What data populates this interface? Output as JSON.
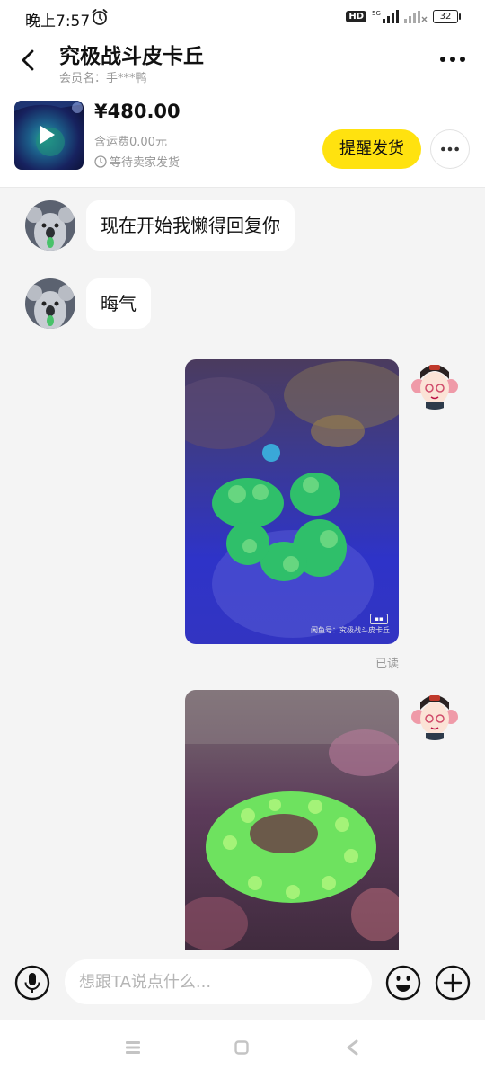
{
  "status_bar": {
    "time": "晚上7:57",
    "network_badge": "HD",
    "signal": "5G",
    "battery": "32"
  },
  "header": {
    "title": "究极战斗皮卡丘",
    "member_label": "会员名：手***鸭",
    "price": "¥480.00",
    "shipping": "含运费0.00元",
    "status": "等待卖家发货",
    "remind_button": "提醒发货"
  },
  "messages": [
    {
      "side": "left",
      "type": "text",
      "text": "现在开始我懒得回复你"
    },
    {
      "side": "left",
      "type": "text",
      "text": "晦气"
    },
    {
      "side": "right",
      "type": "image",
      "subject": "green coral under blue light",
      "watermark": "闲鱼号：究极战斗皮卡丘",
      "status": "已读"
    },
    {
      "side": "right",
      "type": "image",
      "subject": "bright green coral colony"
    }
  ],
  "composer": {
    "placeholder": "想跟TA说点什么..."
  },
  "colors": {
    "accent": "#ffe20f",
    "background": "#f4f4f4",
    "muted_text": "#999999"
  },
  "icons": [
    "back-icon",
    "more-icon",
    "play-icon",
    "clock-icon",
    "microphone-icon",
    "emoji-icon",
    "plus-icon",
    "alarm-icon"
  ]
}
